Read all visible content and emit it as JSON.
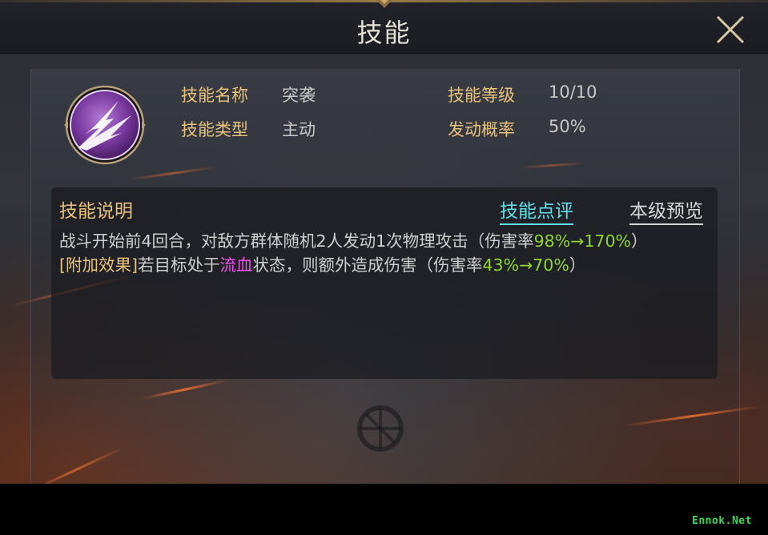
{
  "window": {
    "title": "技能"
  },
  "skill": {
    "icon": "slash-claw-icon",
    "name_label": "技能名称",
    "name_value": "突袭",
    "type_label": "技能类型",
    "type_value": "主动",
    "level_label": "技能等级",
    "level_value": "10/10",
    "rate_label": "发动概率",
    "rate_value": "50%"
  },
  "description": {
    "title": "技能说明",
    "review_link": "技能点评",
    "preview_link": "本级预览",
    "line1_text": "战斗开始前4回合，对敌方群体随机2人发动1次物理攻击（伤害率",
    "line1_rate": "98%→170%",
    "line1_end": "）",
    "extra_tag": "[附加效果]",
    "extra_text": "若目标处于",
    "extra_status": "流血",
    "extra_text2": "状态，则额外造成伤害（伤害率",
    "extra_rate": "43%→70%",
    "extra_end": "）"
  },
  "watermark": "Ennok.Net",
  "colors": {
    "label_gold": "#e8c27a",
    "value_green": "#8fd631",
    "status_pink": "#f050f0",
    "link_cyan": "#5fe0e8",
    "icon_purple": "#7a3aa0"
  }
}
